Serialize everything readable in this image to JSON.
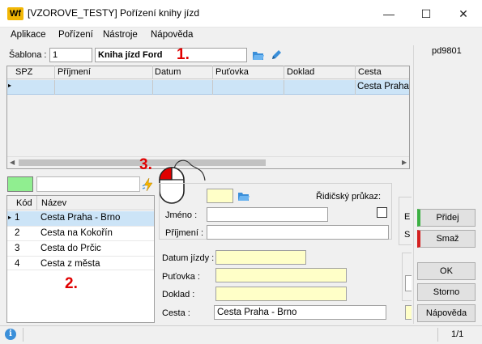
{
  "window": {
    "title": "[VZOROVE_TESTY] Pořízení knihy jízd",
    "app_icon": "Wf",
    "minimize": "—",
    "maximize": "☐",
    "close": "✕"
  },
  "menu": [
    "Aplikace",
    "Pořízení",
    "Nástroje",
    "Nápověda"
  ],
  "user_code": "pd9801",
  "template": {
    "label": "Šablona :",
    "number": "1",
    "name": "Kniha jízd Ford"
  },
  "top_grid": {
    "columns": [
      "SPZ",
      "Příjmení",
      "Datum",
      "Puťovka",
      "Doklad",
      "Cesta"
    ],
    "row": {
      "cesta": "Cesta Praha"
    }
  },
  "list": {
    "columns": [
      "Kód",
      "Název"
    ],
    "rows": [
      {
        "code": "1",
        "name": "Cesta Praha - Brno"
      },
      {
        "code": "2",
        "name": "Cesta na Kokořín"
      },
      {
        "code": "3",
        "name": "Cesta do Prčic"
      },
      {
        "code": "4",
        "name": "Cesta z města"
      }
    ]
  },
  "driver": {
    "jmeno_label": "Jméno :",
    "prijmeni_label": "Příjmení :",
    "ridicsky_label": "Řidičský průkaz:"
  },
  "trip": {
    "datum_label": "Datum jízdy :",
    "putovka_label": "Puťovka :",
    "doklad_label": "Doklad :",
    "cesta_label": "Cesta :",
    "cesta_value": "Cesta Praha - Brno"
  },
  "buttons": {
    "pridej": "Přidej",
    "smaz": "Smaž",
    "ok": "OK",
    "storno": "Storno",
    "napoveda": "Nápověda"
  },
  "side_letters": [
    "E",
    "S"
  ],
  "annotations": [
    "1.",
    "2.",
    "3."
  ],
  "status": {
    "page": "1/1"
  },
  "colors": {
    "selected_row": "#cce4f7",
    "highlight_yellow": "#ffffc8",
    "green_swatch": "#90ee90",
    "annotation_red": "#e00000",
    "pridej_bar": "#3cb043",
    "smaz_bar": "#d42020"
  }
}
